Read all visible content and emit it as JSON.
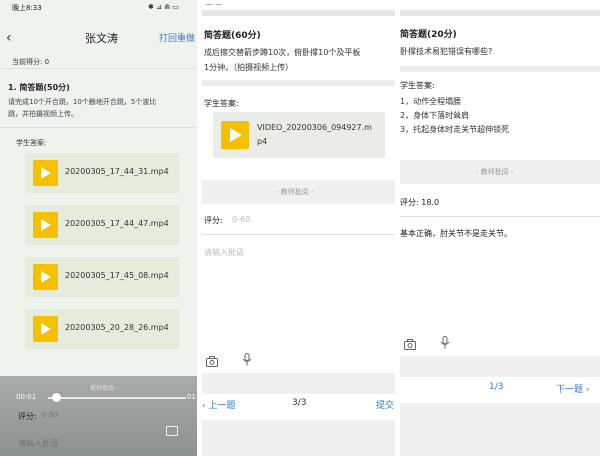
{
  "screen1": {
    "status_time": "晚上8:33",
    "status_icons": "✱ ⊿ ⋒ ▭",
    "title": "张文涛",
    "action": "打回重做",
    "current_score": "当前得分: 0",
    "question_title": "1. 简答题(50分)",
    "question_body_1": "请完成10个开合跳，10个触地开合跳，5个波比",
    "question_body_2": "跳，并拍摄视频上传。",
    "answer_label": "学生答案:",
    "videos": [
      "20200305_17_44_31.mp4",
      "20200305_17_44_47.mp4",
      "20200305_17_45_08.mp4",
      "20200305_20_28_26.mp4"
    ],
    "player_current": "00:01",
    "player_end": "01",
    "review_header": "- 教师批阅 -",
    "score_label": "评分:",
    "score_placeholder": "0-50",
    "comment_placeholder": "请输入批语"
  },
  "screen2": {
    "top_fragment": "— —",
    "question_title": "简答题(60分)",
    "question_line1": "成后擦交替箭步蹲10次，俯卧撑10个及平板",
    "question_line2": "1分钟。（拍摄视频上传）",
    "answer_label": "学生答案:",
    "video_line1": "VIDEO_20200306_094927.m",
    "video_line2": "p4",
    "review_header": "- 教师批阅 -",
    "score_label": "评分:",
    "score_placeholder": "0-60",
    "comment_placeholder": "请输入批语",
    "prev": "‹ 上一题",
    "page": "3/3",
    "submit": "提交"
  },
  "screen3": {
    "question_title": "简答题(20分)",
    "question_line": "卧撑技术易犯错误有哪些?",
    "answer_label": "学生答案:",
    "answers": [
      "1，动作全程塌腰",
      "2，身体下落时耸肩",
      "3，托起身体时走关节超伸锁死"
    ],
    "review_header": "- 教师批阅 -",
    "score": "评分: 18.0",
    "comment": "基本正确，肘关节不是走关节。",
    "page": "1/3",
    "next": "下一题 ›"
  },
  "colors": {
    "accent": "#2f7ad6",
    "play": "#f5c000"
  }
}
